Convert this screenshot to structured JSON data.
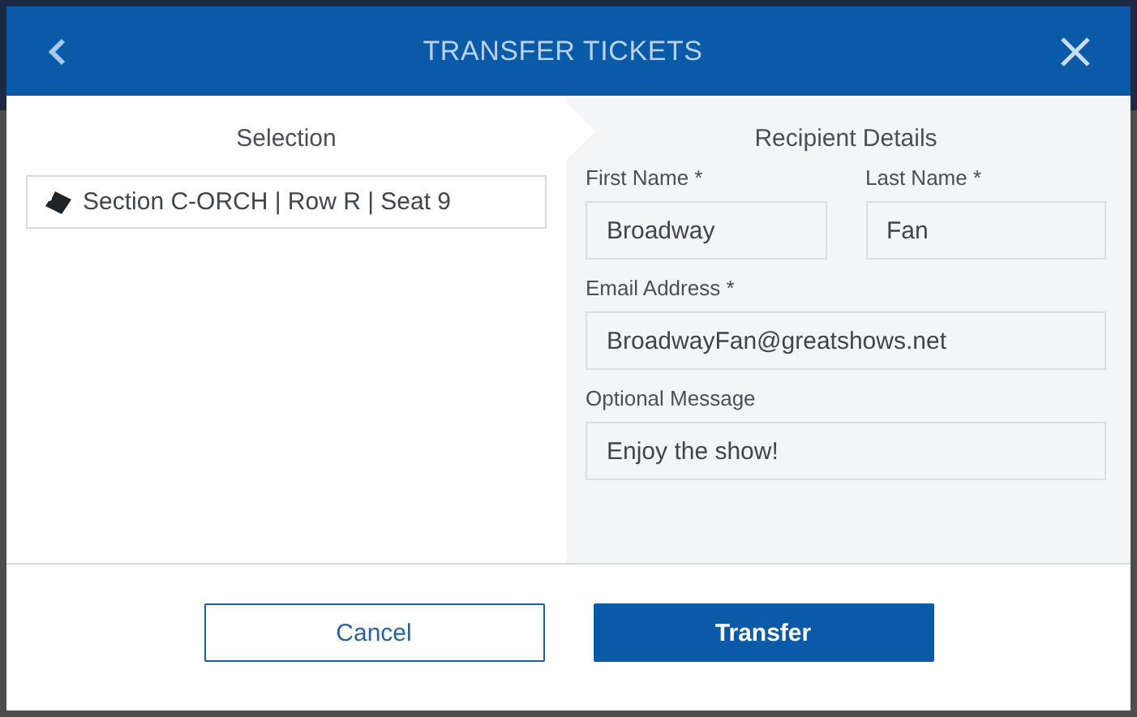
{
  "dialog": {
    "title": "TRANSFER TICKETS"
  },
  "selection": {
    "heading": "Selection",
    "tickets": [
      {
        "label": "Section C-ORCH | Row R | Seat 9"
      }
    ]
  },
  "recipient": {
    "heading": "Recipient Details",
    "name_fields": [
      {
        "label": "First Name *",
        "value": "Broadway"
      },
      {
        "label": "Last Name *",
        "value": "Fan"
      }
    ],
    "fields": [
      {
        "label": "Email Address *",
        "value": "BroadwayFan@greatshows.net"
      },
      {
        "label": "Optional Message",
        "value": "Enjoy the show!"
      }
    ]
  },
  "buttons": [
    {
      "label": "Cancel",
      "kind": "secondary"
    },
    {
      "label": "Transfer",
      "kind": "primary"
    }
  ]
}
